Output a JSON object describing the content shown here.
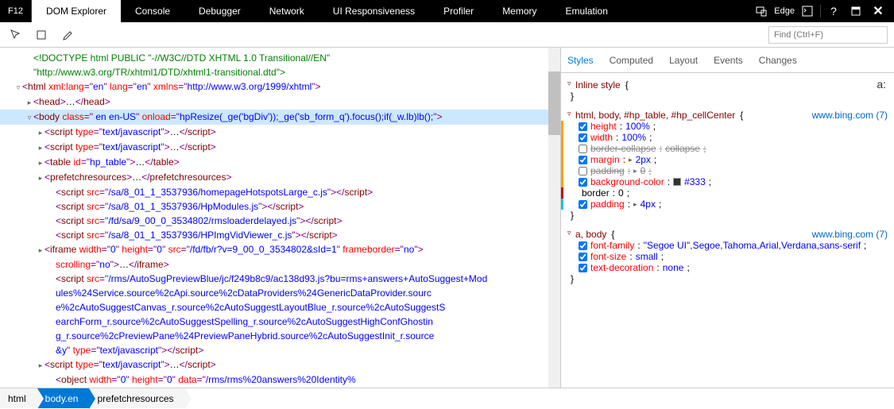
{
  "topbar": {
    "f12": "F12",
    "tabs": [
      "DOM Explorer",
      "Console",
      "Debugger",
      "Network",
      "UI Responsiveness",
      "Profiler",
      "Memory",
      "Emulation"
    ],
    "activeTab": 0,
    "edge": "Edge"
  },
  "find_placeholder": "Find (Ctrl+F)",
  "dom": {
    "doctype1": "<!DOCTYPE html PUBLIC \"-//W3C//DTD XHTML 1.0 Transitional//EN\"",
    "doctype2": "\"http://www.w3.org/TR/xhtml1/DTD/xhtml1-transitional.dtd\">",
    "html_open": "<html ",
    "html_attrs": [
      [
        "xml:lang",
        "en"
      ],
      [
        "lang",
        "en"
      ],
      [
        "xmlns",
        "http://www.w3.org/1999/xhtml"
      ]
    ],
    "head": "<head>…</head>",
    "body_tag": "body",
    "body_class_attr": "class",
    "body_class_val": " en en-US",
    "body_onload_attr": "onload",
    "body_onload_val": "hpResize(_ge('bgDiv'));_ge('sb_form_q').focus();if(_w.lb)lb();",
    "sc_type_attr": "type",
    "sc_type_val": "text/javascript",
    "sc12": "<script type=\"text/javascript\">…</​script>",
    "table": "<table id=\"hp_table\">…</table>",
    "pref": "<prefetchresources>…</prefetchresources>",
    "src1": "/sa/8_01_1_3537936/homepageHotspotsLarge_c.js",
    "src2": "/sa/8_01_1_3537936/HpModules.js",
    "src3": "/fd/sa/9_00_0_3534802/rmsloaderdelayed.js",
    "src4": "/sa/8_01_1_3537936/HPImgVidViewer_c.js",
    "iframe_w": "0",
    "iframe_h": "0",
    "iframe_src": "/fd/fb/r?v=9_00_0_3534802&sId=1",
    "iframe_fb": "no",
    "iframe_sc": "no",
    "long_src": "/rms/AutoSugPreviewBlue/jc/f249b8c9/ac138d93.js?bu=rms+answers+AutoSuggest+Modules%24Service.source%2cApi.source%2cDataProviders%24GenericDataProvider.source%2cAutoSuggestCanvas_r.source%2cAutoSuggestLayoutBlue_r.source%2cAutoSuggestSearchForm_r.source%2cAutoSuggestSpelling_r.source%2cAutoSuggestHighConfGhosting_r.source%2cPreviewPane%24PreviewPaneHybrid.source%2cAutoSuggestInit_r.source&y",
    "obj_data": "/rms/rms%20answers%20Identity%"
  },
  "sidetabs": [
    "Styles",
    "Computed",
    "Layout",
    "Events",
    "Changes"
  ],
  "styles": {
    "inline": "Inline style",
    "r1_sel": "html, body, #hp_table, #hp_cellCenter",
    "src": "www.bing.com (7)",
    "p_height": "height",
    "v_height": "100%",
    "p_width": "width",
    "v_width": "100%",
    "p_bc": "border-collapse",
    "v_bc": "collapse",
    "p_margin": "margin",
    "v_margin": "2px",
    "p_padding": "padding",
    "v_padding": "0",
    "p_bgc": "background-color",
    "v_bgc": "#333",
    "p_border": "border",
    "v_border": "0",
    "p_padding2": "padding",
    "v_padding2": "4px",
    "r2_sel": "a, body",
    "p_ff": "font-family",
    "v_ff": "\"Segoe UI\",Segoe,Tahoma,Arial,Verdana,sans-serif",
    "p_fs": "font-size",
    "v_fs": "small",
    "p_td": "text-decoration",
    "v_td": "none"
  },
  "crumbs": [
    "html",
    "body.en",
    "prefetchresources"
  ],
  "crumb_active": 1
}
